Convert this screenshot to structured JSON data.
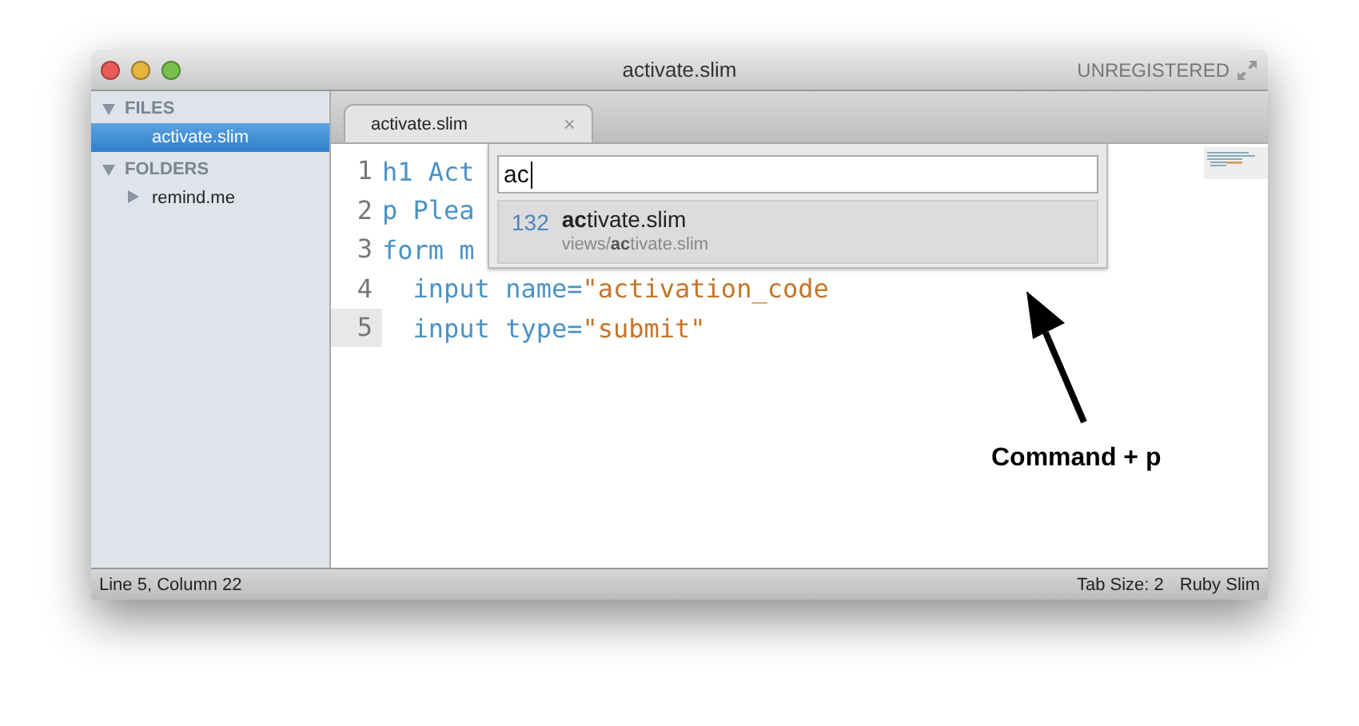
{
  "window": {
    "title": "activate.slim",
    "badge": "UNREGISTERED"
  },
  "sidebar": {
    "sections": [
      {
        "label": "FILES",
        "expanded": true,
        "items": [
          {
            "label": "activate.slim",
            "kind": "file",
            "selected": true
          }
        ]
      },
      {
        "label": "FOLDERS",
        "expanded": true,
        "items": [
          {
            "label": "remind.me",
            "kind": "folder",
            "selected": false,
            "expanded": false
          }
        ]
      }
    ]
  },
  "tabs": [
    {
      "label": "activate.slim",
      "selected": true,
      "close": "×"
    }
  ],
  "editor": {
    "lines": [
      {
        "number": "1",
        "current": false,
        "tokens": [
          {
            "kind": "keyword",
            "text": "h1 Act"
          }
        ]
      },
      {
        "number": "2",
        "current": false,
        "tokens": [
          {
            "kind": "keyword",
            "text": "p Plea"
          }
        ]
      },
      {
        "number": "3",
        "current": false,
        "tokens": [
          {
            "kind": "keyword",
            "text": "form m"
          }
        ]
      },
      {
        "number": "4",
        "current": false,
        "tokens": [
          {
            "kind": "keyword",
            "text": "  input name="
          },
          {
            "kind": "string",
            "text": "\"activation_code"
          }
        ]
      },
      {
        "number": "5",
        "current": true,
        "tokens": [
          {
            "kind": "keyword",
            "text": "  input type="
          },
          {
            "kind": "string",
            "text": "\"submit\""
          }
        ]
      }
    ]
  },
  "goto_anything": {
    "value": "ac",
    "results": [
      {
        "score": "132",
        "match": "ac",
        "name": "tivate.slim",
        "path_before": "views/",
        "path_match": "ac",
        "path_after": "tivate.slim",
        "selected": true
      }
    ]
  },
  "annotation": {
    "text": "Command + p"
  },
  "status_bar": {
    "left": "Line 5, Column 22",
    "tab_size": "Tab Size: 2",
    "syntax": "Ruby Slim"
  }
}
